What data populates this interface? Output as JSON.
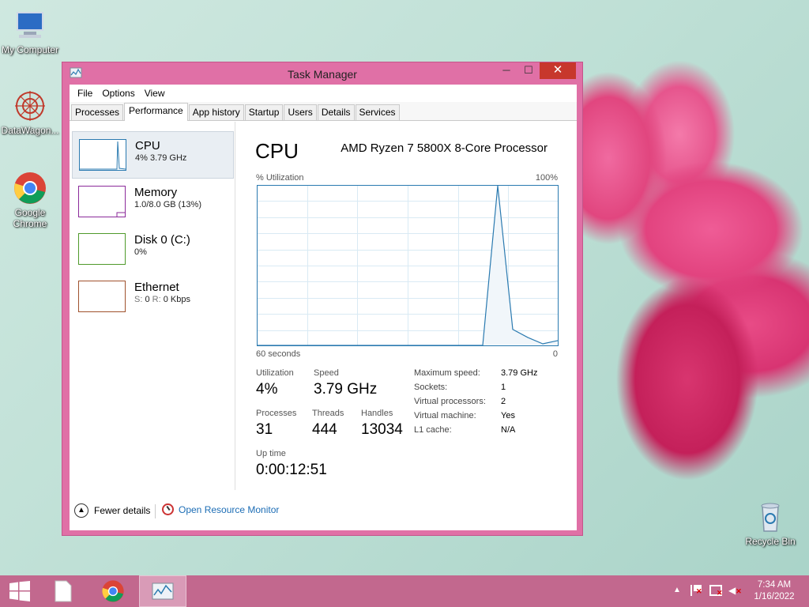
{
  "desktop": {
    "icons": [
      {
        "label": "My Computer",
        "icon": "computer-icon"
      },
      {
        "label": "DataWagon...",
        "icon": "datawagon-icon"
      },
      {
        "label": "Google Chrome",
        "icon": "chrome-icon"
      },
      {
        "label": "Recycle Bin",
        "icon": "recycle-bin-icon"
      }
    ]
  },
  "window": {
    "title": "Task Manager",
    "minimize": "─",
    "maximize": "☐",
    "close": "✕"
  },
  "menu": [
    "File",
    "Options",
    "View"
  ],
  "tabs": [
    "Processes",
    "Performance",
    "App history",
    "Startup",
    "Users",
    "Details",
    "Services"
  ],
  "active_tab": "Performance",
  "sidebar": [
    {
      "name": "CPU",
      "sub": "4%  3.79 GHz",
      "color": "#2a7ab0"
    },
    {
      "name": "Memory",
      "sub": "1.0/8.0 GB (13%)",
      "color": "#8b2a9a"
    },
    {
      "name": "Disk 0 (C:)",
      "sub": "0%",
      "color": "#4f9a2b"
    },
    {
      "name": "Ethernet",
      "sub_s_label": "S:",
      "sub_s": "0",
      "sub_r_label": "R:",
      "sub_r": "0 Kbps",
      "color": "#a0522d"
    }
  ],
  "cpu": {
    "heading": "CPU",
    "processor": "AMD Ryzen 7 5800X 8-Core Processor",
    "util_label": "% Utilization",
    "util_max": "100%",
    "time_left": "60 seconds",
    "time_right": "0",
    "stats": {
      "utilization_label": "Utilization",
      "utilization": "4%",
      "speed_label": "Speed",
      "speed": "3.79 GHz",
      "processes_label": "Processes",
      "processes": "31",
      "threads_label": "Threads",
      "threads": "444",
      "handles_label": "Handles",
      "handles": "13034",
      "uptime_label": "Up time",
      "uptime": "0:00:12:51"
    },
    "details": [
      {
        "key": "Maximum speed:",
        "value": "3.79 GHz"
      },
      {
        "key": "Sockets:",
        "value": "1"
      },
      {
        "key": "Virtual processors:",
        "value": "2"
      },
      {
        "key": "Virtual machine:",
        "value": "Yes"
      },
      {
        "key": "L1 cache:",
        "value": "N/A"
      }
    ]
  },
  "footer": {
    "fewer_details": "Fewer details",
    "open_resource_monitor": "Open Resource Monitor"
  },
  "taskbar": {
    "time": "7:34 AM",
    "date": "1/16/2022"
  },
  "colors": {
    "window_frame": "#e070a6",
    "taskbar": "#c2688e",
    "cpu_graph": "#2a7ab0",
    "link": "#1c6db5"
  },
  "chart_data": {
    "type": "line",
    "title": "",
    "ylabel": "% Utilization",
    "xlabel": "60 seconds",
    "ylim": [
      0,
      100
    ],
    "x": [
      0,
      1,
      2,
      3,
      4,
      5,
      6,
      7,
      8,
      9,
      10,
      11,
      12,
      13,
      14,
      15,
      16,
      17,
      18,
      19,
      20
    ],
    "series": [
      {
        "values": [
          0,
          0,
          0,
          0,
          0,
          0,
          0,
          0,
          0,
          0,
          0,
          0,
          0,
          0,
          0,
          0,
          100,
          10,
          5,
          1,
          3
        ]
      }
    ]
  }
}
